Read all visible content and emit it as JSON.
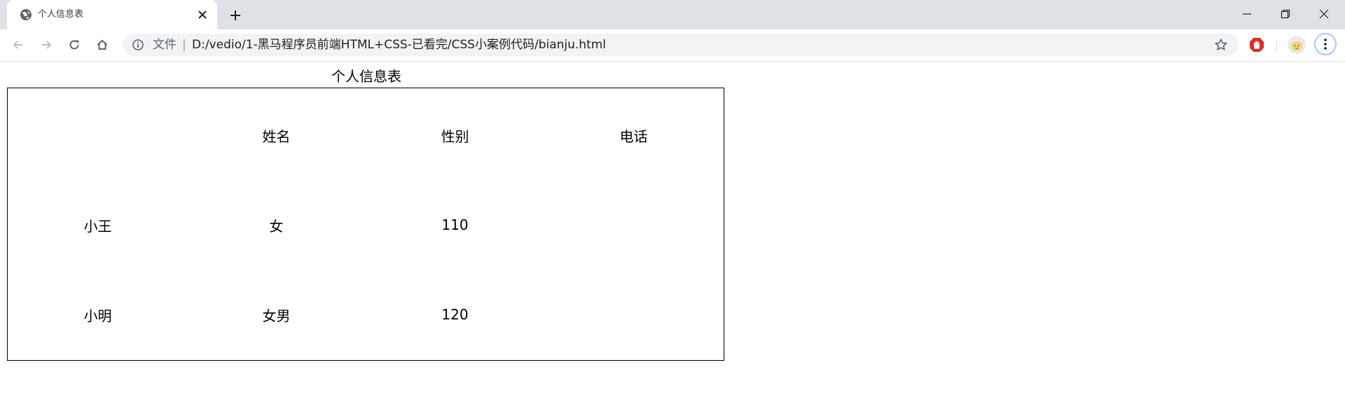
{
  "browser": {
    "tab": {
      "title": "个人信息表",
      "favicon_icon": "globe-icon",
      "close_icon": "close-icon"
    },
    "new_tab_icon": "plus-icon",
    "window_controls": [
      "minimize-icon",
      "restore-icon",
      "close-icon"
    ],
    "toolbar": {
      "back_icon": "arrow-left-icon",
      "forward_icon": "arrow-right-icon",
      "reload_icon": "reload-icon",
      "home_icon": "home-icon"
    },
    "omnibox": {
      "scheme_label": "文件",
      "separator": "|",
      "url": "D:/vedio/1-黑马程序员前端HTML+CSS-已看完/CSS小案例代码/bianju.html",
      "info_icon": "info-icon",
      "bookmark_icon": "star-icon"
    },
    "extensions": [
      "adblock-icon"
    ],
    "profile_icon": "avatar-icon",
    "menu_icon": "kebab-menu-icon"
  },
  "page": {
    "table": {
      "caption": "个人信息表",
      "headers": [
        "",
        "姓名",
        "性别",
        "电话"
      ],
      "rows": [
        [
          "小王",
          "女",
          "110",
          ""
        ],
        [
          "小明",
          "女男",
          "120",
          ""
        ]
      ]
    }
  },
  "colors": {
    "tabstrip_bg": "#dee1e6",
    "omnibox_bg": "#f1f3f4",
    "adblock_red": "#d93025",
    "table_border": "#000000"
  }
}
